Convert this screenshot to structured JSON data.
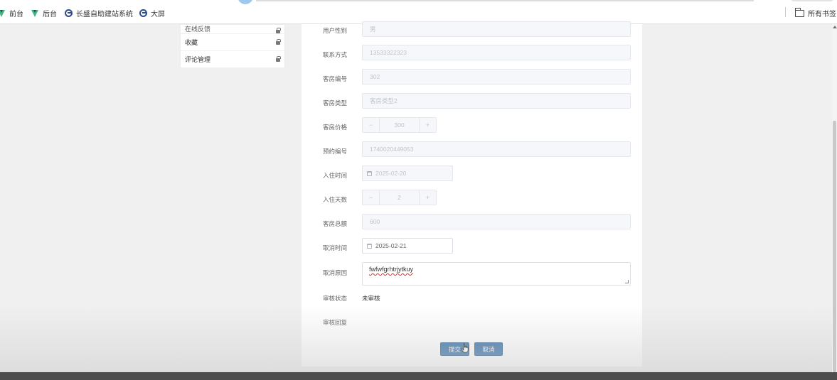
{
  "bookmarks": {
    "items": [
      {
        "label": "前台",
        "icon": "vue-icon"
      },
      {
        "label": "后台",
        "icon": "vue-icon"
      },
      {
        "label": "长盛自助建站系统",
        "icon": "globe-icon"
      },
      {
        "label": "大屏",
        "icon": "globe-icon"
      }
    ],
    "all_bookmarks": "所有书签"
  },
  "sidebar": {
    "items": [
      {
        "label": "在线反馈"
      },
      {
        "label": "收藏"
      },
      {
        "label": "评论管理"
      }
    ]
  },
  "form": {
    "gender": {
      "label": "用户性别",
      "value": "男"
    },
    "contact": {
      "label": "联系方式",
      "value": "13533322323"
    },
    "room_no": {
      "label": "客房编号",
      "value": "302"
    },
    "room_type": {
      "label": "客房类型",
      "value": "客房类型2"
    },
    "room_price": {
      "label": "客房价格",
      "value": "300",
      "minus": "−",
      "plus": "+"
    },
    "booking_no": {
      "label": "预约编号",
      "value": "1740020449053"
    },
    "checkin_date": {
      "label": "入住时间",
      "value": "2025-02-20"
    },
    "stay_days": {
      "label": "入住天数",
      "value": "2",
      "minus": "−",
      "plus": "+"
    },
    "total": {
      "label": "客房总额",
      "value": "600"
    },
    "cancel_date": {
      "label": "取消时间",
      "value": "2025-02-21"
    },
    "cancel_reason": {
      "label": "取消原因",
      "value": "fwfwfgrhtrjytkuy"
    },
    "audit_status": {
      "label": "审核状态",
      "value": "未审核"
    },
    "audit_reply": {
      "label": "审核回复"
    }
  },
  "actions": {
    "submit": "提交",
    "cancel": "取消"
  },
  "colors": {
    "primary_button": "#3f76a8",
    "disabled_bg": "#f5f7fa",
    "page_bg": "#f0f0f0"
  }
}
